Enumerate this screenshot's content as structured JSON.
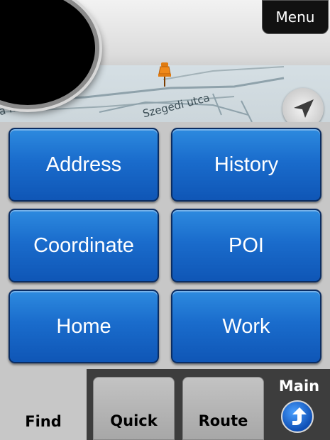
{
  "header": {
    "menu_label": "Menu"
  },
  "map": {
    "streets": [
      "a körút",
      "Szegedi utca"
    ]
  },
  "buttons": {
    "address": "Address",
    "history": "History",
    "coordinate": "Coordinate",
    "poi": "POI",
    "home": "Home",
    "work": "Work"
  },
  "tabs": {
    "find": "Find",
    "quick": "Quick",
    "route": "Route",
    "main": "Main"
  },
  "colors": {
    "button_blue": "#1a6ccc",
    "tab_bar": "#3d3d3d",
    "panel": "#c7c7c7"
  }
}
